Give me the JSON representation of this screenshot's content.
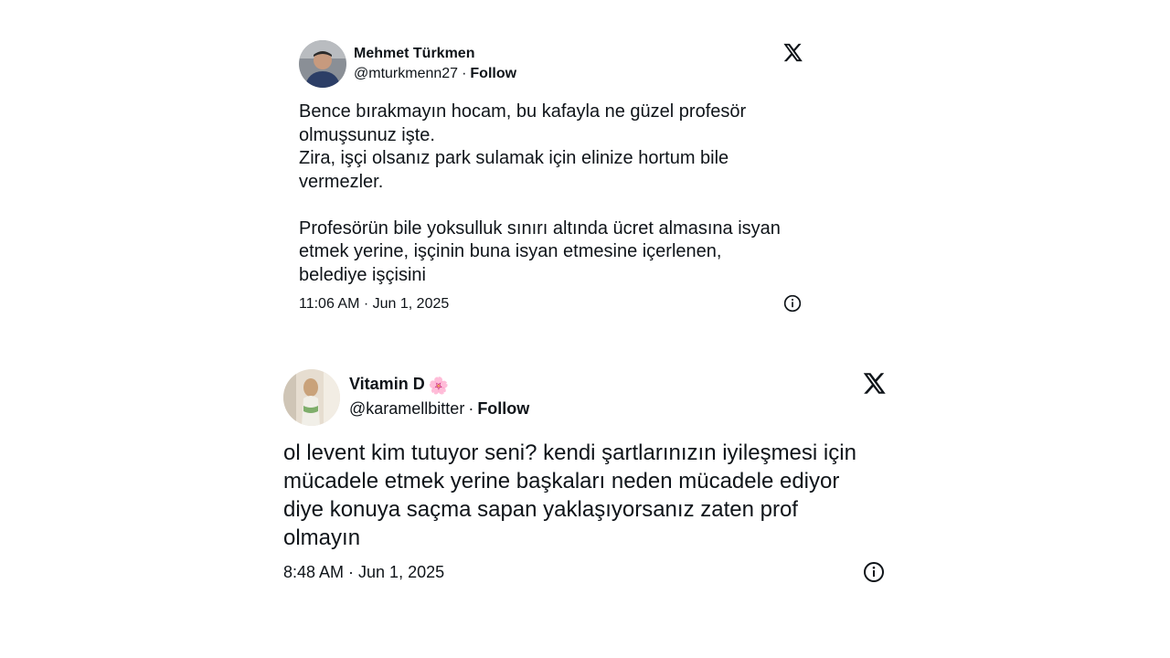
{
  "tweets": [
    {
      "name": "Mehmet Türkmen",
      "handle": "@mturkmenn27",
      "separator": "·",
      "follow_label": "Follow",
      "avatar_icon": "user-avatar",
      "platform_icon": "x-logo-icon",
      "text": "Bence bırakmayın hocam, bu kafayla ne güzel profesör\nolmuşsunuz işte.\nZira, işçi olsanız park sulamak için elinize hortum bile\nvermezler.\n\nProfesörün bile yoksulluk sınırı altında ücret almasına isyan\netmek yerine, işçinin buna isyan etmesine içerlenen,\nbelediye işçisini",
      "timestamp": "11:06 AM · Jun 1, 2025",
      "info_icon": "info-icon"
    },
    {
      "name": "Vitamin D",
      "name_emoji": "🌸",
      "handle": "@karamellbitter",
      "separator": "·",
      "follow_label": "Follow",
      "avatar_icon": "user-avatar",
      "platform_icon": "x-logo-icon",
      "text": "ol levent kim tutuyor seni? kendi şartlarınızın iyileşmesi için\nmücadele etmek yerine başkaları neden mücadele ediyor\ndiye konuya  saçma sapan yaklaşıyorsanız zaten prof\nolmayın",
      "timestamp": "8:48 AM · Jun 1, 2025",
      "info_icon": "info-icon"
    }
  ],
  "colors": {
    "text": "#0f1419",
    "background": "#ffffff"
  }
}
